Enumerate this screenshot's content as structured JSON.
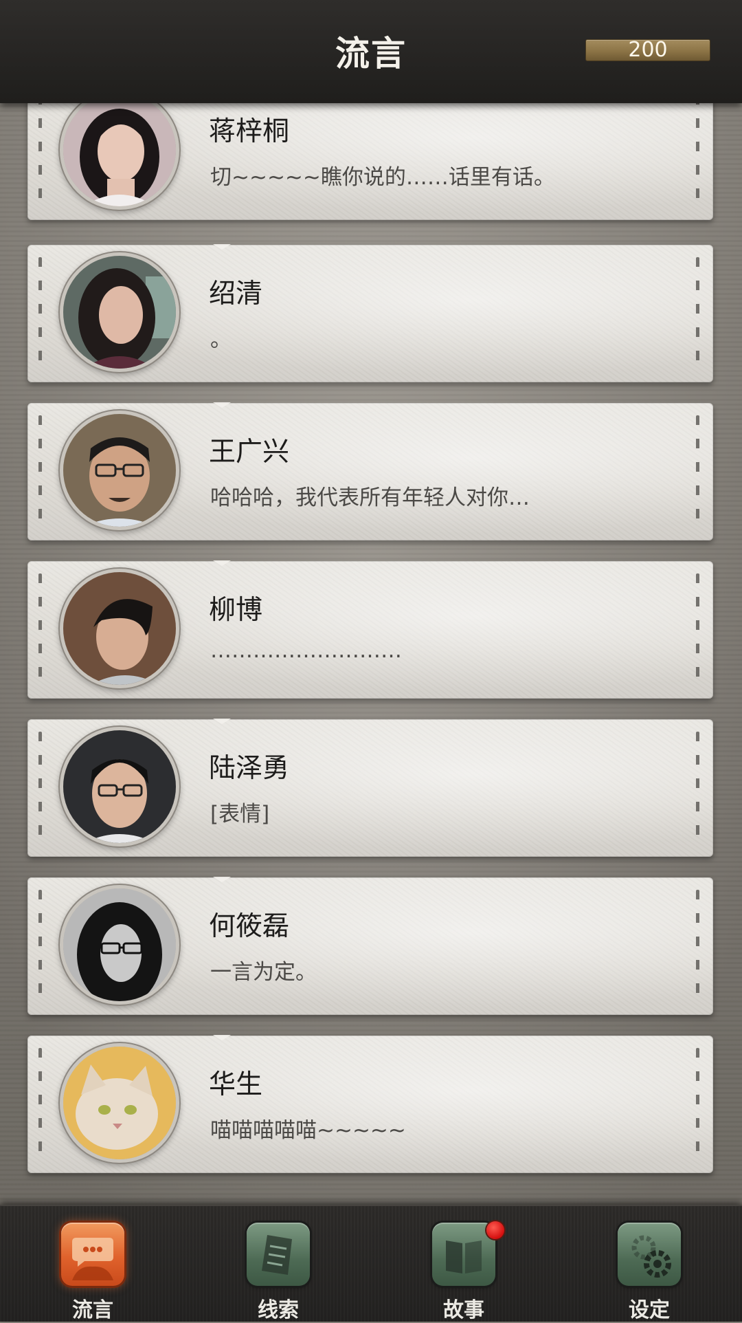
{
  "header": {
    "title": "流言",
    "currency": "200"
  },
  "contacts": [
    {
      "name": "蒋梓桐",
      "message": "切~~~~~瞧你说的……话里有话。"
    },
    {
      "name": "绍清",
      "message": "。"
    },
    {
      "name": "王广兴",
      "message": "哈哈哈，我代表所有年轻人对你…"
    },
    {
      "name": "柳博",
      "message": "………………………"
    },
    {
      "name": "陆泽勇",
      "message": "[表情]"
    },
    {
      "name": "何筱磊",
      "message": "一言为定。"
    },
    {
      "name": "华生",
      "message": "喵喵喵喵喵~~~~~"
    }
  ],
  "tabs": [
    {
      "label": "流言",
      "icon": "chat-bubble-icon",
      "active": true
    },
    {
      "label": "线索",
      "icon": "clue-paper-icon",
      "active": false
    },
    {
      "label": "故事",
      "icon": "story-book-icon",
      "active": false,
      "badge": true
    },
    {
      "label": "设定",
      "icon": "settings-gear-icon",
      "active": false
    }
  ],
  "colors": {
    "active_tab": "#e0622c",
    "inactive_tab": "#4d6a54",
    "badge": "#d40f0f",
    "currency_bar": "#8c7446"
  }
}
